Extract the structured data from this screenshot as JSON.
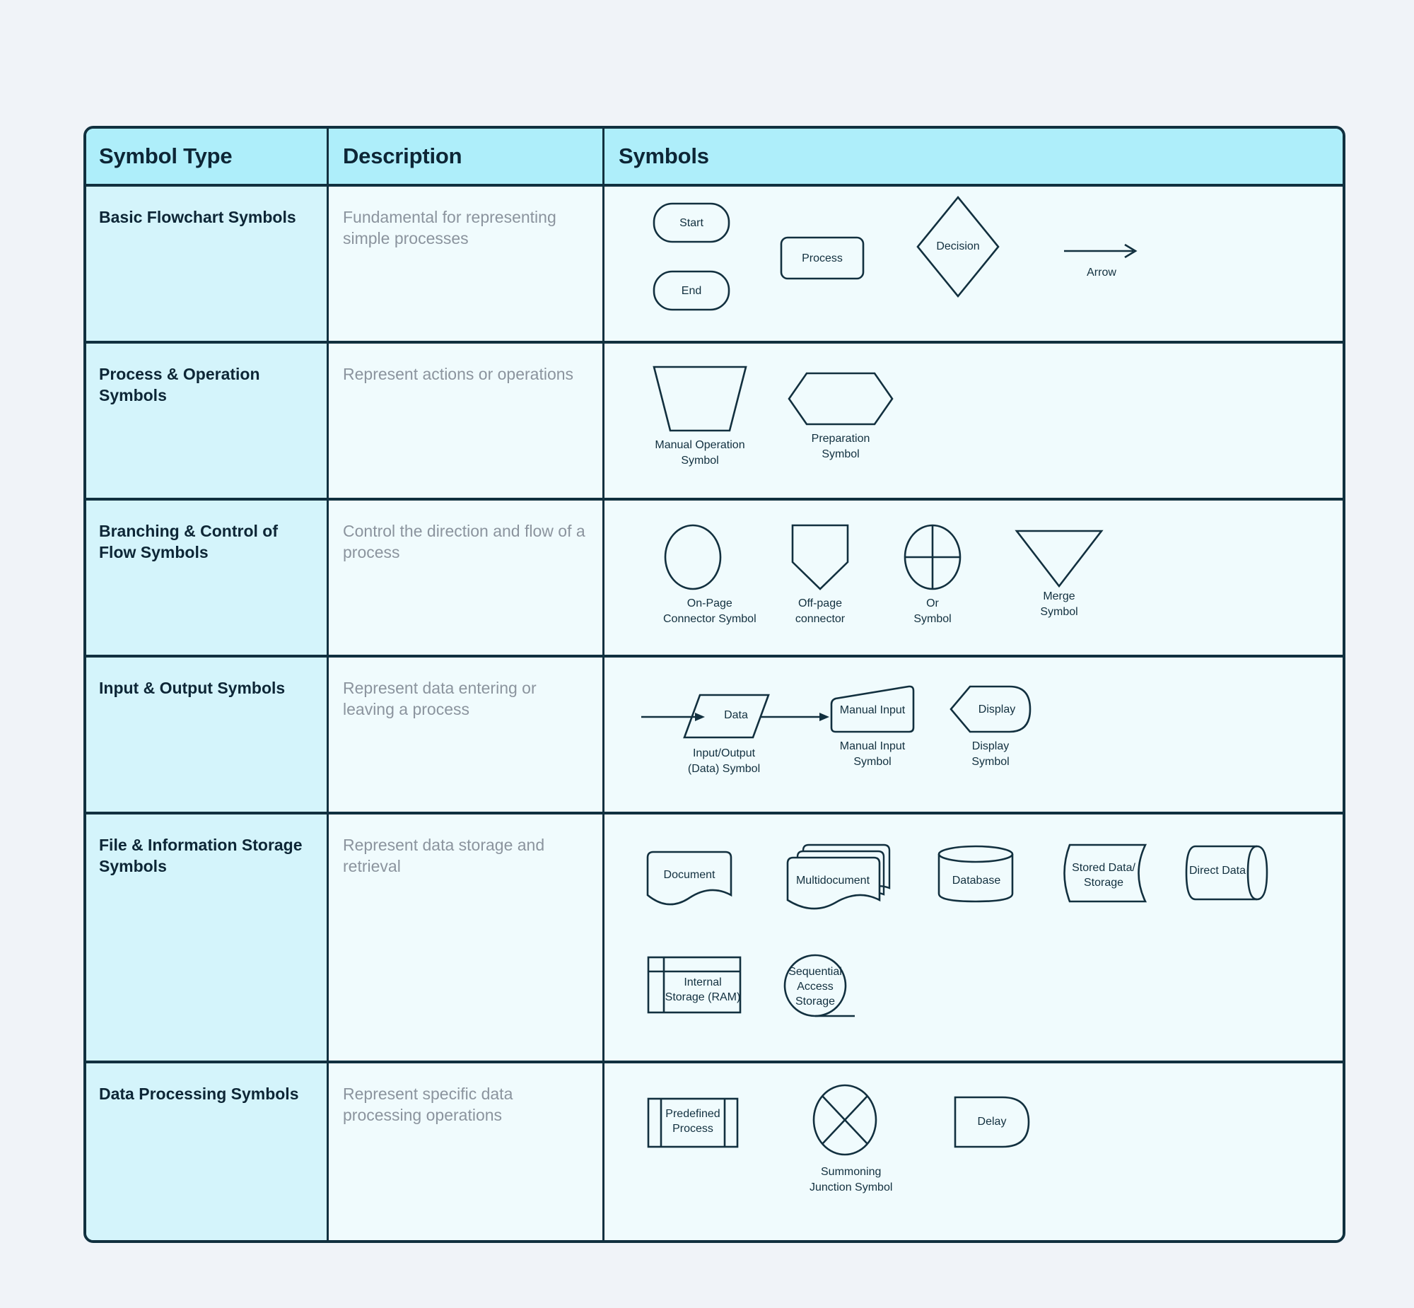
{
  "table": {
    "headers": {
      "col1": "Symbol Type",
      "col2": "Description",
      "col3": "Symbols"
    },
    "rows": [
      {
        "type": "Basic Flowchart Symbols",
        "description": "Fundamental for representing simple processes",
        "symbols": [
          {
            "name": "Start",
            "label": "Start",
            "shape": "stadium"
          },
          {
            "name": "End",
            "label": "End",
            "shape": "stadium"
          },
          {
            "name": "Process",
            "label": "Process",
            "shape": "rounded-rect"
          },
          {
            "name": "Decision",
            "label": "Decision",
            "shape": "diamond"
          },
          {
            "name": "Arrow",
            "label": "Arrow",
            "shape": "arrow"
          }
        ]
      },
      {
        "type": "Process & Operation Symbols",
        "description": "Represent actions or operations",
        "symbols": [
          {
            "name": "Manual Operation Symbol",
            "label": "Manual Operation\nSymbol",
            "shape": "inverted-trapezoid"
          },
          {
            "name": "Preparation Symbol",
            "label": "Preparation\nSymbol",
            "shape": "hexagon"
          }
        ]
      },
      {
        "type": "Branching & Control of Flow Symbols",
        "description": "Control the direction and flow of a process",
        "symbols": [
          {
            "name": "On-Page Connector Symbol",
            "label": "On-Page\nConnector Symbol",
            "shape": "ellipse"
          },
          {
            "name": "Off-page connector",
            "label": "Off-page\nconnector",
            "shape": "pentagon-down"
          },
          {
            "name": "Or Symbol",
            "label": "Or\nSymbol",
            "shape": "circle-cross"
          },
          {
            "name": "Merge Symbol",
            "label": "Merge\nSymbol",
            "shape": "triangle-down"
          }
        ]
      },
      {
        "type": "Input & Output Symbols",
        "description": "Represent data entering or leaving a process",
        "symbols": [
          {
            "name": "Input/Output (Data) Symbol",
            "label": "Input/Output\n(Data) Symbol",
            "inner": "Data",
            "shape": "parallelogram-arrows"
          },
          {
            "name": "Manual Input Symbol",
            "label": "Manual Input\nSymbol",
            "inner": "Manual Input",
            "shape": "manual-input"
          },
          {
            "name": "Display Symbol",
            "label": "Display\nSymbol",
            "inner": "Display",
            "shape": "display"
          }
        ]
      },
      {
        "type": "File & Information Storage Symbols",
        "description": "Represent data storage and retrieval",
        "symbols": [
          {
            "name": "Document",
            "inner": "Document",
            "shape": "document"
          },
          {
            "name": "Multidocument",
            "inner": "Multidocument",
            "shape": "multidocument"
          },
          {
            "name": "Database",
            "inner": "Database",
            "shape": "cylinder-vertical"
          },
          {
            "name": "Stored Data/Storage",
            "inner": "Stored Data/\nStorage",
            "shape": "stored-data"
          },
          {
            "name": "Direct Data",
            "inner": "Direct Data",
            "shape": "cylinder-horizontal"
          },
          {
            "name": "Internal Storage (RAM)",
            "inner": "Internal\nStorage (RAM)",
            "shape": "internal-storage"
          },
          {
            "name": "Sequential Access Storage",
            "inner": "Sequential\nAccess\nStorage",
            "shape": "sequential-access"
          }
        ]
      },
      {
        "type": "Data Processing Symbols",
        "description": "Represent specific data processing operations",
        "symbols": [
          {
            "name": "Predefined Process",
            "inner": "Predefined\nProcess",
            "shape": "predefined-process"
          },
          {
            "name": "Summoning Junction Symbol",
            "label": "Summoning\nJunction Symbol",
            "shape": "circle-x"
          },
          {
            "name": "Delay",
            "inner": "Delay",
            "shape": "delay"
          }
        ]
      }
    ]
  },
  "colors": {
    "page_background": "#f0f3f8",
    "header_background": "#aeeefa",
    "type_cell_background": "#d4f4fb",
    "body_background": "#f0fbfd",
    "border": "#11303f",
    "stroke": "#12303f",
    "description_text": "#8b949e",
    "heading_text": "#0d2636"
  }
}
